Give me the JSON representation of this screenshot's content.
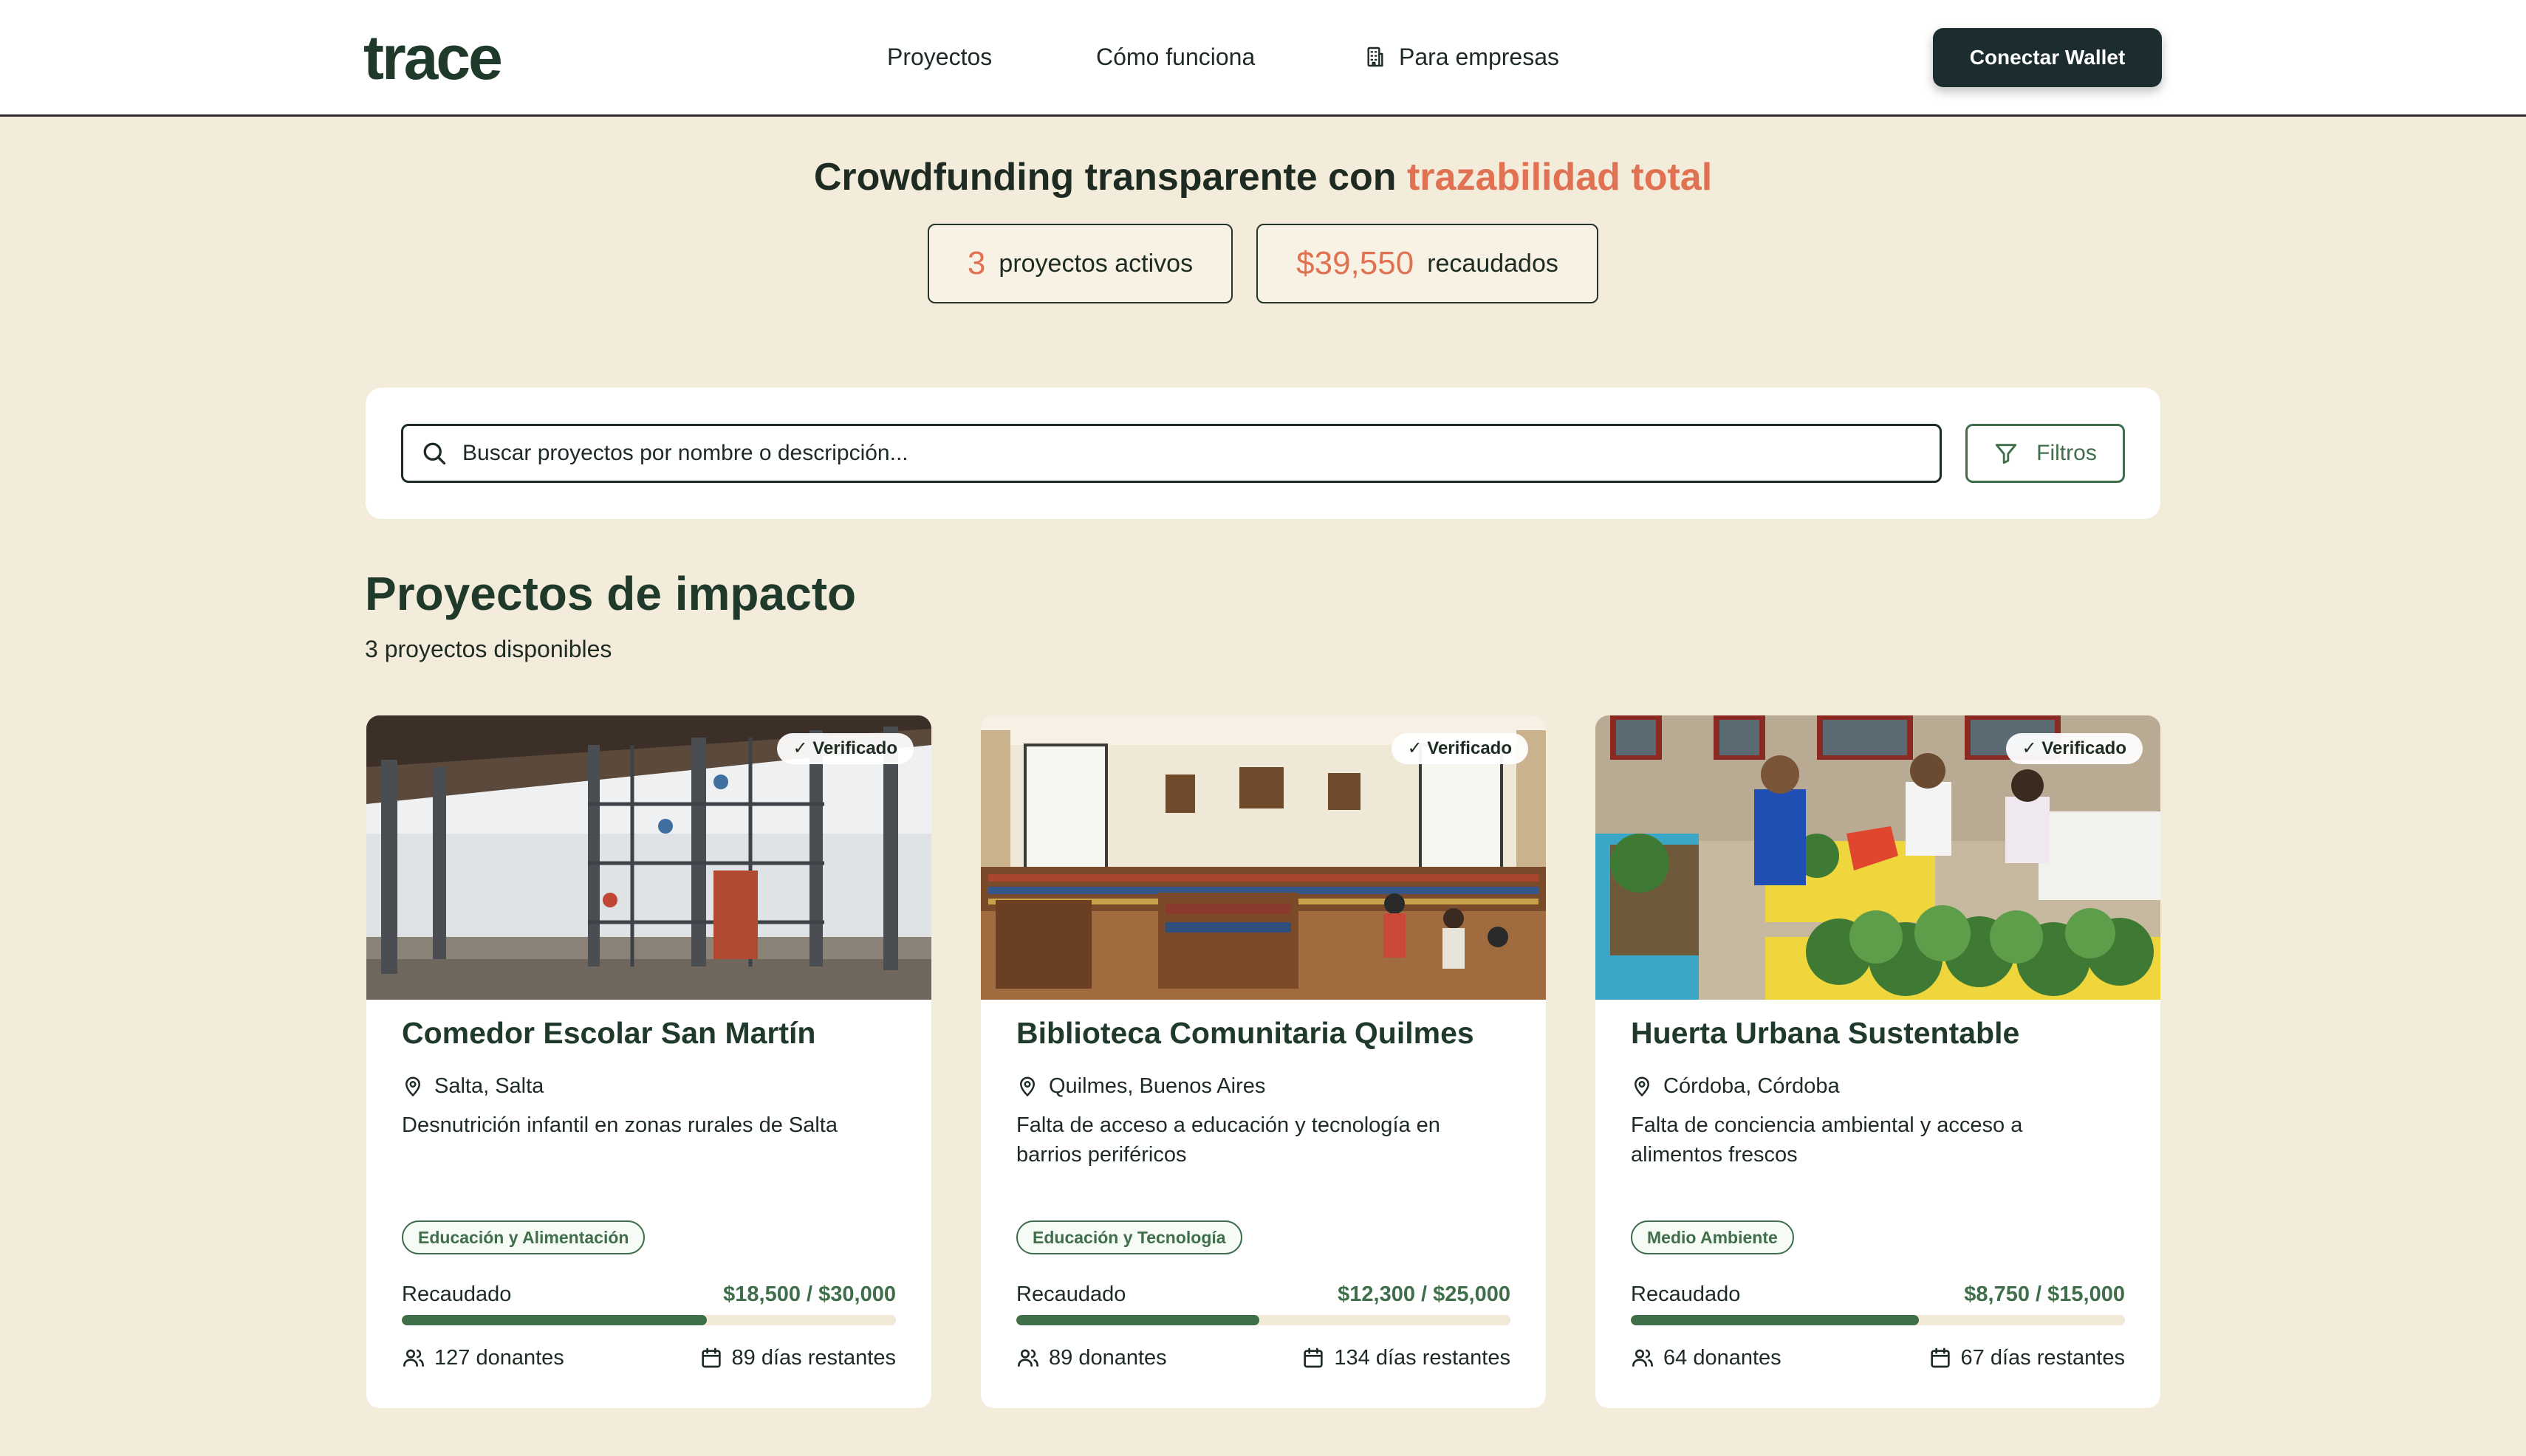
{
  "header": {
    "logo": "trace",
    "nav": [
      {
        "label": "Proyectos"
      },
      {
        "label": "Cómo funciona"
      },
      {
        "label": "Para empresas",
        "icon": "building-icon"
      }
    ],
    "wallet_button": "Conectar Wallet"
  },
  "hero": {
    "title_main": "Crowdfunding transparente con ",
    "title_accent": "trazabilidad total",
    "stats": [
      {
        "value": "3",
        "label": "proyectos activos"
      },
      {
        "value": "$39,550",
        "label": "recaudados"
      }
    ]
  },
  "search": {
    "placeholder": "Buscar proyectos por nombre o descripción...",
    "filter_label": "Filtros"
  },
  "section": {
    "title": "Proyectos de impacto",
    "count_text": "3 proyectos disponibles"
  },
  "projects": [
    {
      "badge": "✓ Verificado",
      "title": "Comedor Escolar San Martín",
      "location": "Salta, Salta",
      "description": "Desnutrición infantil en zonas rurales de Salta",
      "tag": "Educación y Alimentación",
      "raised_label": "Recaudado",
      "raised_amount": "$18,500 / $30,000",
      "progress": 0.617,
      "donors": "127 donantes",
      "days": "89 días restantes"
    },
    {
      "badge": "✓ Verificado",
      "title": "Biblioteca Comunitaria Quilmes",
      "location": "Quilmes, Buenos Aires",
      "description": "Falta de acceso a educación y tecnología en barrios periféricos",
      "tag": "Educación y Tecnología",
      "raised_label": "Recaudado",
      "raised_amount": "$12,300 / $25,000",
      "progress": 0.492,
      "donors": "89 donantes",
      "days": "134 días restantes"
    },
    {
      "badge": "✓ Verificado",
      "title": "Huerta Urbana Sustentable",
      "location": "Córdoba, Córdoba",
      "description": "Falta de conciencia ambiental y acceso a alimentos frescos",
      "tag": "Medio Ambiente",
      "raised_label": "Recaudado",
      "raised_amount": "$8,750 / $15,000",
      "progress": 0.583,
      "donors": "64 donantes",
      "days": "67 días restantes"
    }
  ],
  "colors": {
    "background": "#f4ecda",
    "accent": "#e07253",
    "primary_green": "#3f6e4a",
    "dark": "#1c2d30"
  }
}
